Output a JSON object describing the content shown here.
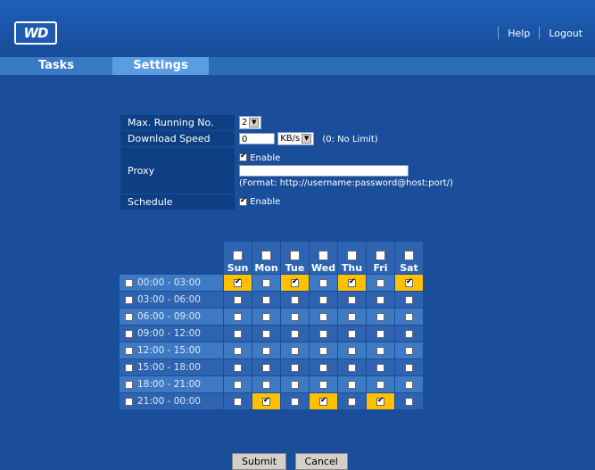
{
  "header": {
    "logo_text": "WD",
    "help_label": "Help",
    "logout_label": "Logout"
  },
  "tabs": [
    {
      "label": "Tasks"
    },
    {
      "label": "Settings"
    }
  ],
  "form": {
    "max_running_label": "Max. Running No.",
    "max_running_value": "2",
    "download_speed_label": "Download Speed",
    "download_speed_value": "0",
    "download_speed_unit": "KB/s",
    "download_speed_note": "(0: No Limit)",
    "proxy_label": "Proxy",
    "proxy_enable_label": "Enable",
    "proxy_value": "",
    "proxy_format_note": "(Format: http://username:password@host:port/)",
    "schedule_label": "Schedule",
    "schedule_enable_label": "Enable"
  },
  "schedule": {
    "days": [
      "Sun",
      "Mon",
      "Tue",
      "Wed",
      "Thu",
      "Fri",
      "Sat"
    ],
    "rows": [
      {
        "label": "00:00 - 03:00",
        "checked": [
          true,
          false,
          true,
          false,
          true,
          false,
          true
        ]
      },
      {
        "label": "03:00 - 06:00",
        "checked": [
          false,
          false,
          false,
          false,
          false,
          false,
          false
        ]
      },
      {
        "label": "06:00 - 09:00",
        "checked": [
          false,
          false,
          false,
          false,
          false,
          false,
          false
        ]
      },
      {
        "label": "09:00 - 12:00",
        "checked": [
          false,
          false,
          false,
          false,
          false,
          false,
          false
        ]
      },
      {
        "label": "12:00 - 15:00",
        "checked": [
          false,
          false,
          false,
          false,
          false,
          false,
          false
        ]
      },
      {
        "label": "15:00 - 18:00",
        "checked": [
          false,
          false,
          false,
          false,
          false,
          false,
          false
        ]
      },
      {
        "label": "18:00 - 21:00",
        "checked": [
          false,
          false,
          false,
          false,
          false,
          false,
          false
        ]
      },
      {
        "label": "21:00 - 00:00",
        "checked": [
          false,
          true,
          false,
          true,
          false,
          true,
          false
        ]
      }
    ]
  },
  "buttons": {
    "submit_label": "Submit",
    "cancel_label": "Cancel"
  },
  "colors": {
    "background": "#1a4e9a",
    "highlight": "#ffc000",
    "label_bg": "#0e3f82"
  }
}
